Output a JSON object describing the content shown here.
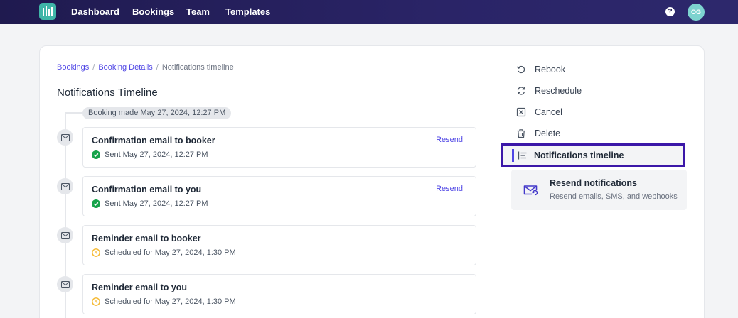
{
  "nav": {
    "links": [
      "Dashboard",
      "Bookings",
      "Team",
      "Templates"
    ],
    "help_glyph": "?",
    "avatar_initials": "OG",
    "icons": {
      "logo": "bar-logo-icon",
      "help": "help-icon"
    }
  },
  "breadcrumb": {
    "items": [
      "Bookings",
      "Booking Details",
      "Notifications timeline"
    ],
    "separator": "/"
  },
  "page": {
    "title": "Notifications Timeline"
  },
  "timeline": {
    "booking_made": "Booking made May 27, 2024, 12:27 PM",
    "items": [
      {
        "title": "Confirmation email to booker",
        "status": "Sent May 27, 2024, 12:27 PM",
        "status_type": "sent",
        "action": "Resend"
      },
      {
        "title": "Confirmation email to you",
        "status": "Sent May 27, 2024, 12:27 PM",
        "status_type": "sent",
        "action": "Resend"
      },
      {
        "title": "Reminder email to booker",
        "status": "Scheduled for May 27, 2024, 1:30 PM",
        "status_type": "scheduled",
        "action": ""
      },
      {
        "title": "Reminder email to you",
        "status": "Scheduled for May 27, 2024, 1:30 PM",
        "status_type": "scheduled",
        "action": ""
      }
    ]
  },
  "sidebar": {
    "items": [
      {
        "label": "Rebook",
        "icon": "rebook-icon"
      },
      {
        "label": "Reschedule",
        "icon": "reschedule-icon"
      },
      {
        "label": "Cancel",
        "icon": "cancel-icon"
      },
      {
        "label": "Delete",
        "icon": "trash-icon"
      }
    ],
    "active": {
      "label": "Notifications timeline",
      "icon": "list-icon"
    },
    "resend": {
      "title": "Resend notifications",
      "subtitle": "Resend emails, SMS, and webhooks",
      "icon": "mail-resend-icon"
    }
  },
  "colors": {
    "nav_bg": "#231d57",
    "accent": "#4f46e5",
    "active_border": "#3b17a8",
    "sent": "#16a34a",
    "scheduled": "#f5b82e",
    "logo_bg": "#3fb6a8",
    "avatar_bg": "#7dd3cf"
  }
}
